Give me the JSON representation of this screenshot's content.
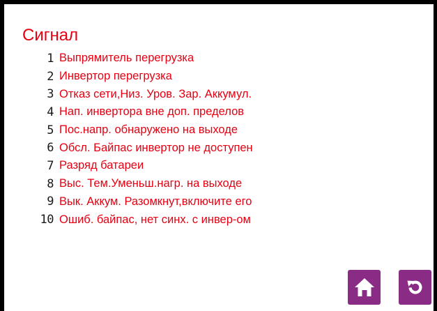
{
  "screen": {
    "title": "Сигнал",
    "alarms": [
      {
        "num": "1",
        "text": "Выпрямитель перегрузка"
      },
      {
        "num": "2",
        "text": "Инвертор перегрузка"
      },
      {
        "num": "3",
        "text": "Отказ сети,Низ. Уров. Зар. Аккумул."
      },
      {
        "num": "4",
        "text": "Нап. инвертора вне доп. пределов"
      },
      {
        "num": "5",
        "text": "Пос.напр. обнаружено на выходе"
      },
      {
        "num": "6",
        "text": "Обсл. Байпас инвертор не доступен"
      },
      {
        "num": "7",
        "text": "Разряд батареи"
      },
      {
        "num": "8",
        "text": "Выс. Тем.Уменьш.нагр. на выходе"
      },
      {
        "num": "9",
        "text": "Вык. Аккум. Разомкнут,включите его"
      },
      {
        "num": "10",
        "text": "Ошиб. байпас, нет синх. с инвер-ом"
      }
    ]
  },
  "buttons": {
    "home_icon": "home-icon",
    "refresh_icon": "refresh-icon"
  },
  "colors": {
    "title": "#e60012",
    "alarm_text": "#e60012",
    "alarm_number": "#1a1a1a",
    "button_bg": "#8a2c86",
    "icon": "#ffffff",
    "frame": "#000000"
  }
}
